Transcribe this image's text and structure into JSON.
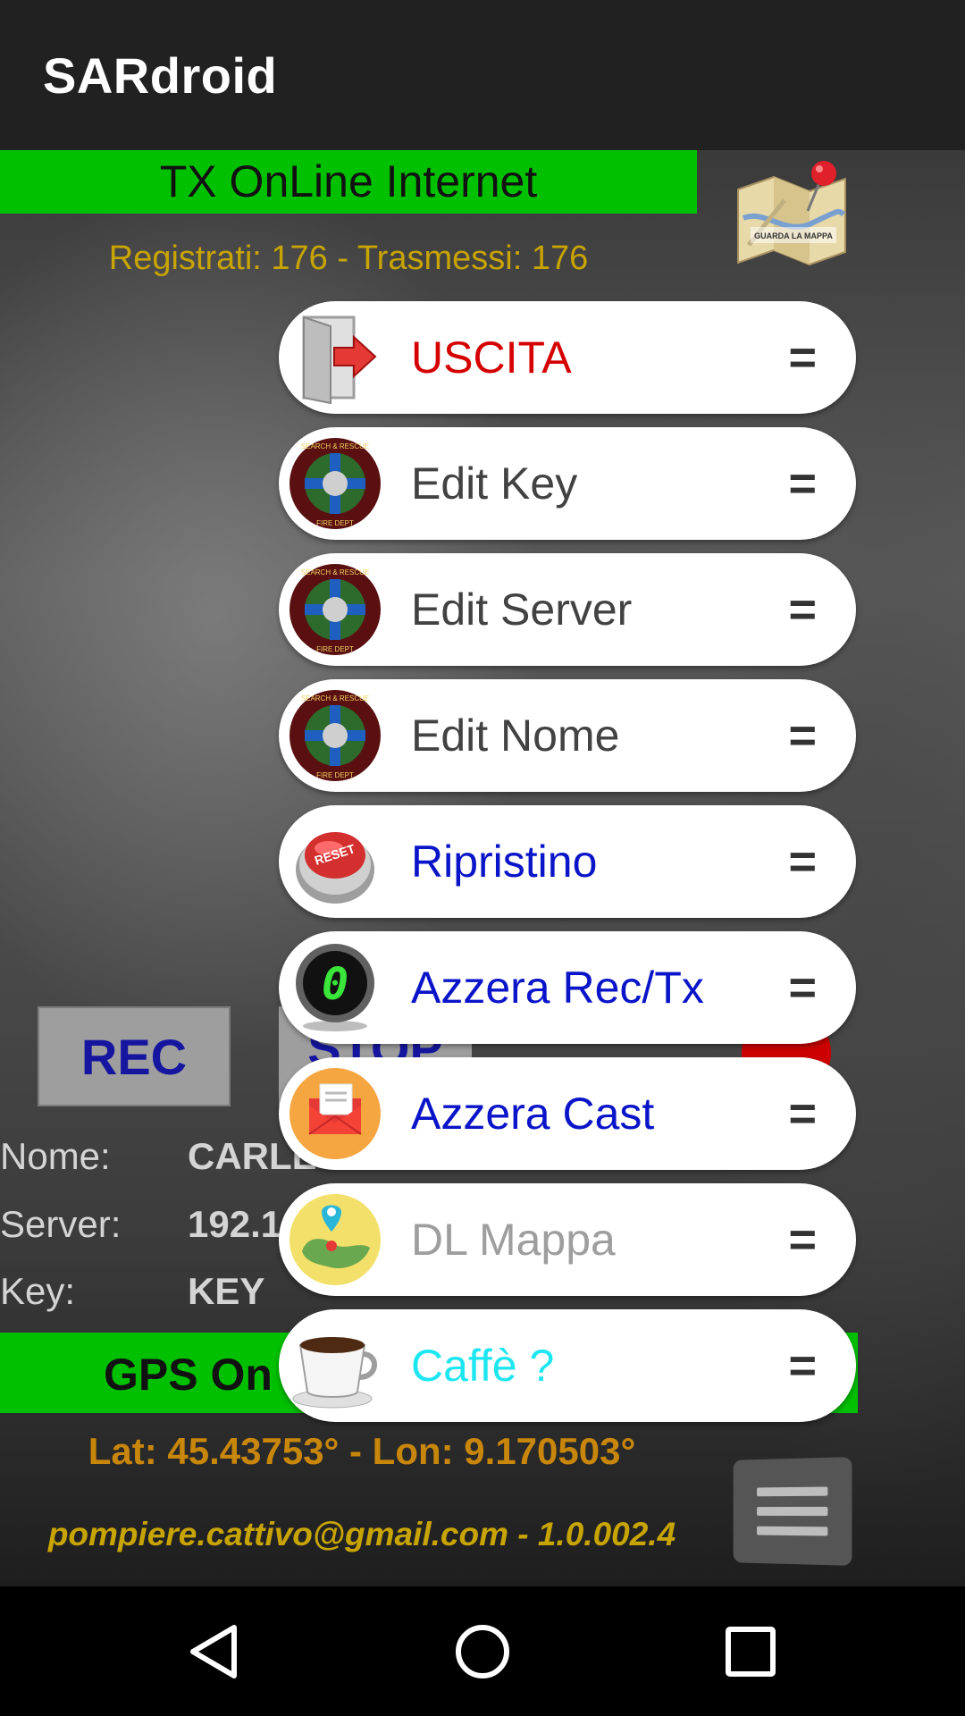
{
  "appbar": {
    "title": "SARdroid"
  },
  "status": {
    "tx_label": "TX OnLine Internet",
    "counts": "Registrati: 176 - Trasmessi: 176",
    "map_icon_text": "GUARDA LA MAPPA"
  },
  "buttons": {
    "rec": "REC",
    "stop": "STOP"
  },
  "info": {
    "nome_label": "Nome:",
    "nome_value": "CARLETTI",
    "server_label": "Server:",
    "server_value": "192.1",
    "key_label": "Key:",
    "key_value": "KEY"
  },
  "gps": {
    "label": "GPS On",
    "latlon": "Lat: 45.43753° - Lon: 9.170503°"
  },
  "footer": {
    "email": "pompiere.cattivo@gmail.com - 1.0.002.4"
  },
  "menu": {
    "handle": "=",
    "items": [
      {
        "label": "USCITA",
        "icon": "exit-door-icon",
        "color": "#d50000"
      },
      {
        "label": "Edit Key",
        "icon": "search-rescue-badge-icon",
        "color": "#424242"
      },
      {
        "label": "Edit Server",
        "icon": "search-rescue-badge-icon",
        "color": "#424242"
      },
      {
        "label": "Edit Nome",
        "icon": "search-rescue-badge-icon",
        "color": "#424242"
      },
      {
        "label": "Ripristino",
        "icon": "reset-button-icon",
        "color": "#0a14c8"
      },
      {
        "label": "Azzera Rec/Tx",
        "icon": "zero-counter-icon",
        "color": "#0a14c8"
      },
      {
        "label": "Azzera Cast",
        "icon": "mail-icon",
        "color": "#0a14c8"
      },
      {
        "label": "DL Mappa",
        "icon": "map-pin-icon",
        "color": "#9e9e9e"
      },
      {
        "label": "Caffè ?",
        "icon": "coffee-cup-icon",
        "color": "#1ee6f0"
      }
    ],
    "badge_top": "SEARCH & RESCUE",
    "badge_bottom": "FIRE DEPT",
    "reset_text": "RESET",
    "counter_digit": "0"
  },
  "colors": {
    "appbar": "#212121",
    "banner_green": "#00c000",
    "counts_text": "#c8a400",
    "latlon_text": "#c8860a",
    "rec_text": "#1515a0"
  }
}
